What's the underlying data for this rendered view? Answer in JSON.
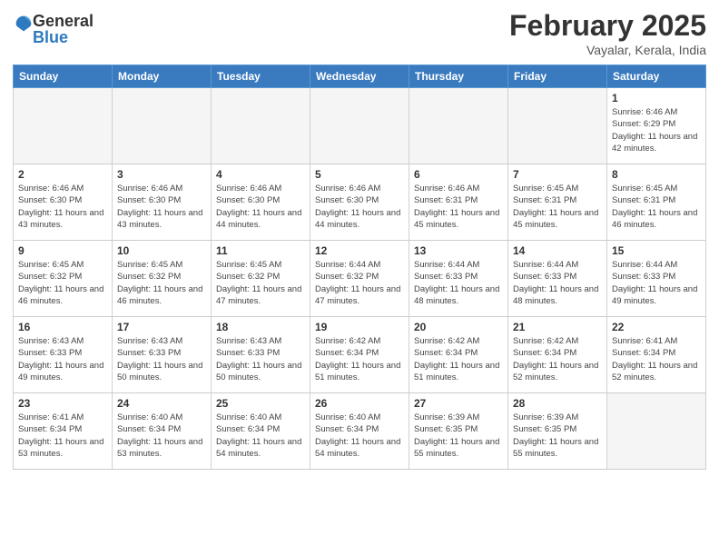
{
  "header": {
    "logo": {
      "general": "General",
      "blue": "Blue"
    },
    "title": "February 2025",
    "subtitle": "Vayalar, Kerala, India"
  },
  "days_of_week": [
    "Sunday",
    "Monday",
    "Tuesday",
    "Wednesday",
    "Thursday",
    "Friday",
    "Saturday"
  ],
  "weeks": [
    [
      {
        "day": "",
        "info": ""
      },
      {
        "day": "",
        "info": ""
      },
      {
        "day": "",
        "info": ""
      },
      {
        "day": "",
        "info": ""
      },
      {
        "day": "",
        "info": ""
      },
      {
        "day": "",
        "info": ""
      },
      {
        "day": "1",
        "info": "Sunrise: 6:46 AM\nSunset: 6:29 PM\nDaylight: 11 hours and 42 minutes."
      }
    ],
    [
      {
        "day": "2",
        "info": "Sunrise: 6:46 AM\nSunset: 6:30 PM\nDaylight: 11 hours and 43 minutes."
      },
      {
        "day": "3",
        "info": "Sunrise: 6:46 AM\nSunset: 6:30 PM\nDaylight: 11 hours and 43 minutes."
      },
      {
        "day": "4",
        "info": "Sunrise: 6:46 AM\nSunset: 6:30 PM\nDaylight: 11 hours and 44 minutes."
      },
      {
        "day": "5",
        "info": "Sunrise: 6:46 AM\nSunset: 6:30 PM\nDaylight: 11 hours and 44 minutes."
      },
      {
        "day": "6",
        "info": "Sunrise: 6:46 AM\nSunset: 6:31 PM\nDaylight: 11 hours and 45 minutes."
      },
      {
        "day": "7",
        "info": "Sunrise: 6:45 AM\nSunset: 6:31 PM\nDaylight: 11 hours and 45 minutes."
      },
      {
        "day": "8",
        "info": "Sunrise: 6:45 AM\nSunset: 6:31 PM\nDaylight: 11 hours and 46 minutes."
      }
    ],
    [
      {
        "day": "9",
        "info": "Sunrise: 6:45 AM\nSunset: 6:32 PM\nDaylight: 11 hours and 46 minutes."
      },
      {
        "day": "10",
        "info": "Sunrise: 6:45 AM\nSunset: 6:32 PM\nDaylight: 11 hours and 46 minutes."
      },
      {
        "day": "11",
        "info": "Sunrise: 6:45 AM\nSunset: 6:32 PM\nDaylight: 11 hours and 47 minutes."
      },
      {
        "day": "12",
        "info": "Sunrise: 6:44 AM\nSunset: 6:32 PM\nDaylight: 11 hours and 47 minutes."
      },
      {
        "day": "13",
        "info": "Sunrise: 6:44 AM\nSunset: 6:33 PM\nDaylight: 11 hours and 48 minutes."
      },
      {
        "day": "14",
        "info": "Sunrise: 6:44 AM\nSunset: 6:33 PM\nDaylight: 11 hours and 48 minutes."
      },
      {
        "day": "15",
        "info": "Sunrise: 6:44 AM\nSunset: 6:33 PM\nDaylight: 11 hours and 49 minutes."
      }
    ],
    [
      {
        "day": "16",
        "info": "Sunrise: 6:43 AM\nSunset: 6:33 PM\nDaylight: 11 hours and 49 minutes."
      },
      {
        "day": "17",
        "info": "Sunrise: 6:43 AM\nSunset: 6:33 PM\nDaylight: 11 hours and 50 minutes."
      },
      {
        "day": "18",
        "info": "Sunrise: 6:43 AM\nSunset: 6:33 PM\nDaylight: 11 hours and 50 minutes."
      },
      {
        "day": "19",
        "info": "Sunrise: 6:42 AM\nSunset: 6:34 PM\nDaylight: 11 hours and 51 minutes."
      },
      {
        "day": "20",
        "info": "Sunrise: 6:42 AM\nSunset: 6:34 PM\nDaylight: 11 hours and 51 minutes."
      },
      {
        "day": "21",
        "info": "Sunrise: 6:42 AM\nSunset: 6:34 PM\nDaylight: 11 hours and 52 minutes."
      },
      {
        "day": "22",
        "info": "Sunrise: 6:41 AM\nSunset: 6:34 PM\nDaylight: 11 hours and 52 minutes."
      }
    ],
    [
      {
        "day": "23",
        "info": "Sunrise: 6:41 AM\nSunset: 6:34 PM\nDaylight: 11 hours and 53 minutes."
      },
      {
        "day": "24",
        "info": "Sunrise: 6:40 AM\nSunset: 6:34 PM\nDaylight: 11 hours and 53 minutes."
      },
      {
        "day": "25",
        "info": "Sunrise: 6:40 AM\nSunset: 6:34 PM\nDaylight: 11 hours and 54 minutes."
      },
      {
        "day": "26",
        "info": "Sunrise: 6:40 AM\nSunset: 6:34 PM\nDaylight: 11 hours and 54 minutes."
      },
      {
        "day": "27",
        "info": "Sunrise: 6:39 AM\nSunset: 6:35 PM\nDaylight: 11 hours and 55 minutes."
      },
      {
        "day": "28",
        "info": "Sunrise: 6:39 AM\nSunset: 6:35 PM\nDaylight: 11 hours and 55 minutes."
      },
      {
        "day": "",
        "info": ""
      }
    ]
  ]
}
